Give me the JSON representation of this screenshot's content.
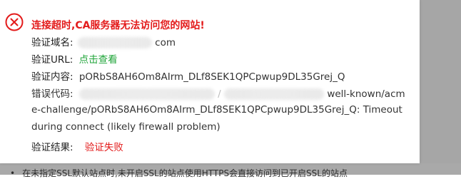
{
  "dialog": {
    "title": "连接超时,CA服务器无法访问您的网站!",
    "domain_label": "验证域名:",
    "domain_value_tail": "com",
    "url_label": "验证URL:",
    "url_link": "点击查看",
    "content_label": "验证内容:",
    "content_value": "pORbS8AH6Om8AIrm_DLf8SEK1QPCpwup9DL35Grej_Q",
    "error_label": "错误代码:",
    "error_line1_tail": "well-known/acm",
    "error_line2": "e-challenge/pORbS8AH6Om8AIrm_DLf8SEK1QPCpwup9DL35Grej_Q: Timeout",
    "error_line3": "during connect (likely firewall problem)",
    "result_label": "验证结果:",
    "result_value": "验证失败"
  },
  "background": {
    "bottom_text": "在未指定SSL默认站点时,未开启SSL的站点使用HTTPS会直接访问到已开启SSL的站点"
  },
  "colors": {
    "error_red": "#e31b1b",
    "link_green": "#20a53a"
  }
}
